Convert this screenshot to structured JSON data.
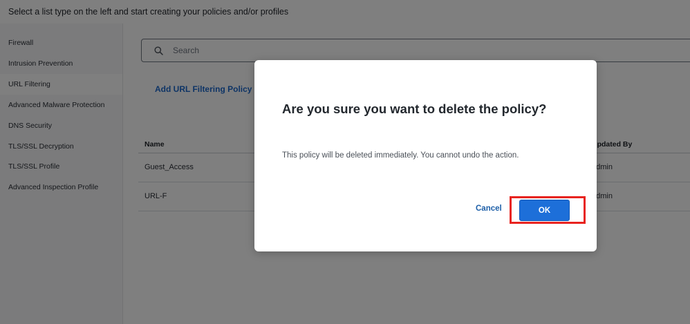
{
  "header": {
    "instruction": "Select a list type on the left and start creating your policies and/or profiles"
  },
  "sidebar": {
    "items": [
      {
        "label": "Firewall"
      },
      {
        "label": "Intrusion Prevention"
      },
      {
        "label": "URL Filtering",
        "active": true
      },
      {
        "label": "Advanced Malware Protection"
      },
      {
        "label": "DNS Security"
      },
      {
        "label": "TLS/SSL Decryption"
      },
      {
        "label": "TLS/SSL Profile"
      },
      {
        "label": "Advanced Inspection Profile"
      }
    ]
  },
  "main": {
    "search": {
      "placeholder": "Search",
      "icon": "search-icon"
    },
    "add_policy_label": "Add URL Filtering Policy",
    "table": {
      "columns": {
        "name": "Name",
        "updated_by": "Updated By"
      },
      "rows": [
        {
          "name": "Guest_Access",
          "updated_by": "admin"
        },
        {
          "name": "URL-F",
          "updated_by": "admin"
        }
      ]
    }
  },
  "dialog": {
    "title": "Are you sure you want to delete the policy?",
    "message": "This policy will be deleted immediately. You cannot undo the action.",
    "cancel_label": "Cancel",
    "ok_label": "OK"
  },
  "colors": {
    "accent": "#1d6fd9",
    "link": "#1d69cc",
    "highlight": "#e8231f",
    "overlay": "rgba(0,0,0,0.5)"
  }
}
